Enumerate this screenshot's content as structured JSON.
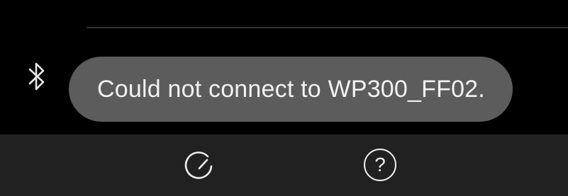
{
  "toast": {
    "message": "Could not connect to WP300_FF02."
  },
  "status": {
    "icon": "bluetooth-icon"
  },
  "bottom_bar": {
    "items": [
      {
        "icon": "refresh-icon"
      },
      {
        "icon": "help-icon",
        "glyph": "?"
      }
    ]
  },
  "colors": {
    "background": "#000000",
    "toast_background": "#5c5c5c",
    "toast_text": "#f2f2f2",
    "bottom_bar": "#212121",
    "icon": "#ededed"
  }
}
